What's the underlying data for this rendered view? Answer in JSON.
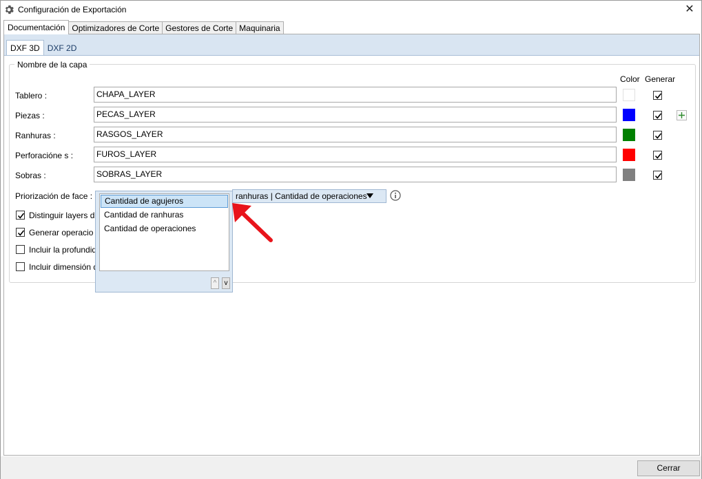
{
  "window": {
    "title": "Configuración de Exportación",
    "close_symbol": "✕"
  },
  "tabs": [
    {
      "label": "Documentación",
      "active": true
    },
    {
      "label": "Optimizadores de Corte",
      "active": false
    },
    {
      "label": "Gestores de Corte",
      "active": false
    },
    {
      "label": "Maquinaria",
      "active": false
    }
  ],
  "subtabs": [
    {
      "label": "DXF 3D",
      "active": true
    },
    {
      "label": "DXF 2D",
      "active": false
    }
  ],
  "group": {
    "legend": "Nombre de la capa",
    "col_color": "Color",
    "col_generar": "Generar"
  },
  "layers": [
    {
      "label": "Tablero :",
      "value": "CHAPA_LAYER",
      "color": "#ffffff",
      "generar": true
    },
    {
      "label": "Piezas :",
      "value": "PECAS_LAYER",
      "color": "#0000ff",
      "generar": true
    },
    {
      "label": "Ranhuras :",
      "value": "RASGOS_LAYER",
      "color": "#008000",
      "generar": true
    },
    {
      "label": "Perforacióne s :",
      "value": "FUROS_LAYER",
      "color": "#ff0000",
      "generar": true
    },
    {
      "label": "Sobras :",
      "value": "SOBRAS_LAYER",
      "color": "#808080",
      "generar": true
    }
  ],
  "priorizacion": {
    "label": "Priorización de face :",
    "combo_text": "ranhuras | Cantidad de operaciones"
  },
  "options": [
    {
      "label": "Distinguir layers d",
      "checked": true
    },
    {
      "label": "Generar operacio",
      "checked": true
    },
    {
      "label": "Incluir la profundid",
      "checked": false
    },
    {
      "label": "Incluir dimensión d",
      "checked": false
    }
  ],
  "dropdown": {
    "items": [
      "Cantidad de agujeros",
      "Cantidad de ranhuras",
      "Cantidad de operaciones"
    ],
    "selected_index": 0,
    "up_label": "^",
    "down_label": "v"
  },
  "footer": {
    "close_label": "Cerrar"
  },
  "icons": {
    "title_icon": "gear-icon",
    "close_icon": "close-icon",
    "add_icon": "plus-icon",
    "info_icon": "info-icon",
    "pointer_arrow": "red-arrow-icon"
  },
  "accent": {
    "subtab_strip": "#d9e5f2",
    "selection": "#cce4f7",
    "arrow": "#e8141b"
  }
}
